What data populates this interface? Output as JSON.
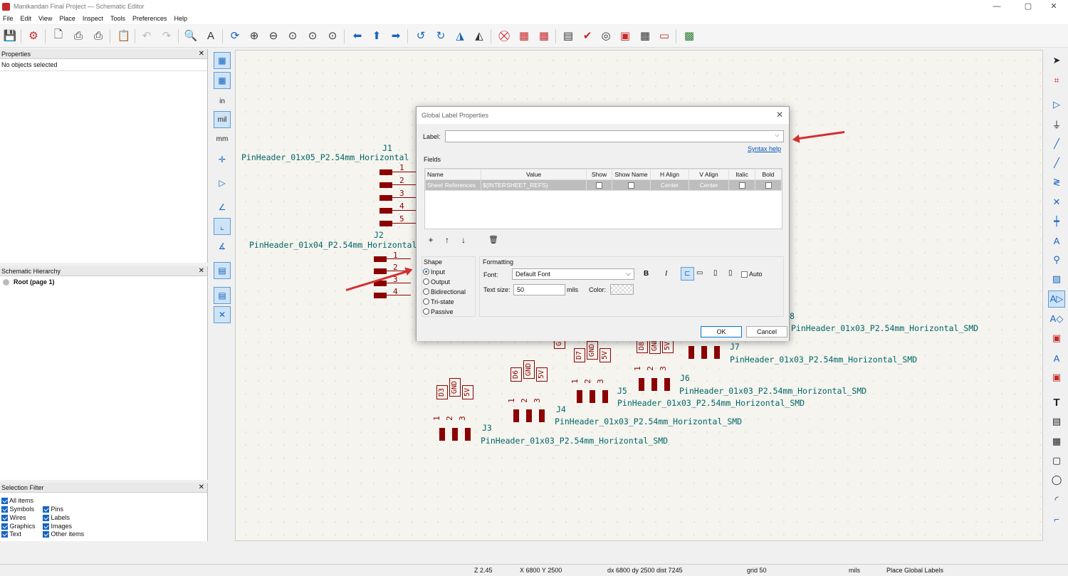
{
  "window": {
    "title": "Manikandan Final Project — Schematic Editor",
    "controls": [
      "—",
      "▢",
      "✕"
    ]
  },
  "menu": [
    "File",
    "Edit",
    "View",
    "Place",
    "Inspect",
    "Tools",
    "Preferences",
    "Help"
  ],
  "panels": {
    "properties": {
      "title": "Properties",
      "status": "No objects selected"
    },
    "hierarchy": {
      "title": "Schematic Hierarchy",
      "root": "Root (page 1)"
    },
    "selection_filter": {
      "title": "Selection Filter",
      "items": [
        {
          "label": "All items",
          "checked": true
        },
        {
          "label": "Symbols",
          "checked": true
        },
        {
          "label": "Pins",
          "checked": true
        },
        {
          "label": "Wires",
          "checked": true
        },
        {
          "label": "Labels",
          "checked": true
        },
        {
          "label": "Graphics",
          "checked": true
        },
        {
          "label": "Images",
          "checked": true
        },
        {
          "label": "Text",
          "checked": true
        },
        {
          "label": "Other items",
          "checked": true
        }
      ]
    }
  },
  "left_toolbar": {
    "units": [
      "in",
      "mil",
      "mm"
    ]
  },
  "schematic": {
    "J1": {
      "ref": "J1",
      "value": "PinHeader_01x05_P2.54mm_Horizontal",
      "pins": [
        "1",
        "2",
        "3",
        "4",
        "5"
      ]
    },
    "J2": {
      "ref": "J2",
      "value": "PinHeader_01x04_P2.54mm_Horizontal",
      "pins": [
        "1",
        "2",
        "3",
        "4"
      ]
    },
    "J3": {
      "ref": "J3",
      "value": "PinHeader_01x03_P2.54mm_Horizontal_SMD",
      "labels": [
        "D3",
        "GND",
        "5V"
      ]
    },
    "J4": {
      "ref": "J4",
      "value": "PinHeader_01x03_P2.54mm_Horizontal_SMD",
      "labels": [
        "D6",
        "GND",
        "5V"
      ]
    },
    "J5": {
      "ref": "J5",
      "value": "PinHeader_01x03_P2.54mm_Horizontal_SMD",
      "labels": [
        "D7",
        "GND",
        "5V"
      ]
    },
    "J6": {
      "ref": "J6",
      "value": "PinHeader_01x03_P2.54mm_Horizontal_SMD",
      "labels": [
        "D8",
        "GND",
        "5V"
      ]
    },
    "J7": {
      "ref": "J7",
      "value": "PinHeader_01x03_P2.54mm_Horizontal_SMD"
    },
    "J8": {
      "ref": "8",
      "value": "PinHeader_01x03_P2.54mm_Horizontal_SMD"
    },
    "pin_numbers": [
      "1",
      "2",
      "3"
    ],
    "partial_label": "G"
  },
  "dialog": {
    "title": "Global Label Properties",
    "label_caption": "Label:",
    "label_value": "",
    "syntax_help": "Syntax help",
    "fields_caption": "Fields",
    "fields_columns": [
      "Name",
      "Value",
      "Show",
      "Show Name",
      "H Align",
      "V Align",
      "Italic",
      "Bold"
    ],
    "fields_rows": [
      {
        "name": "Sheet References",
        "value": "${INTERSHEET_REFS}",
        "show": false,
        "show_name": false,
        "h_align": "Center",
        "v_align": "Center",
        "italic": false,
        "bold": false
      }
    ],
    "shape_caption": "Shape",
    "shapes": [
      "Input",
      "Output",
      "Bidirectional",
      "Tri-state",
      "Passive"
    ],
    "shape_selected": "Input",
    "formatting_caption": "Formatting",
    "font_caption": "Font:",
    "font_value": "Default Font",
    "bold_label": "B",
    "italic_label": "I",
    "auto_label": "Auto",
    "text_size_caption": "Text size:",
    "text_size_value": "50",
    "text_size_unit": "mils",
    "color_caption": "Color:",
    "ok_label": "OK",
    "cancel_label": "Cancel"
  },
  "status": {
    "zoom": "Z 2.45",
    "xy": "X 6800  Y 2500",
    "delta": "dx 6800  dy 2500  dist 7245",
    "grid": "grid 50",
    "units": "mils",
    "tool": "Place Global Labels"
  },
  "colors": {
    "accent": "#1565c0",
    "schematic_part": "#8b0000",
    "schematic_text": "#006666",
    "annotation_arrow": "#d32f2f"
  }
}
